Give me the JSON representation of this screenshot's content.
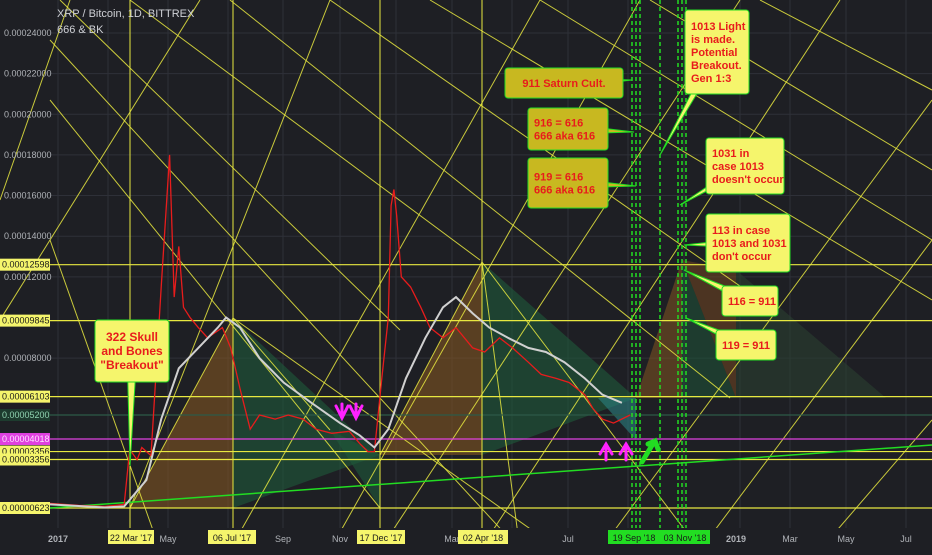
{
  "header": {
    "title": "XRP / Bitcoin, 1D, BITTREX",
    "subtitle": "666 & BK"
  },
  "chart_data": {
    "type": "line",
    "y_ticks": [
      "0.00024000",
      "0.00022000",
      "0.00020000",
      "0.00018000",
      "0.00016000",
      "0.00014000",
      "0.00012000",
      "0.00008000"
    ],
    "y_tick_values": [
      0.00024,
      0.00022,
      0.0002,
      0.00018,
      0.00016,
      0.00014,
      0.00012,
      8e-05
    ],
    "price_labels": [
      {
        "text": "0.00012598",
        "value": 0.00012598,
        "bg": "#f5f56c"
      },
      {
        "text": "0.00009845",
        "value": 9.845e-05,
        "bg": "#f5f56c"
      },
      {
        "text": "0.00006103",
        "value": 6.103e-05,
        "bg": "#f5f56c"
      },
      {
        "text": "0.00005200",
        "value": 5.2e-05,
        "bg": "#1d3b2e"
      },
      {
        "text": "0.00004018",
        "value": 4.018e-05,
        "bg": "#e040e0"
      },
      {
        "text": "0.00003356",
        "value": 3.4e-05,
        "bg": "#f5f56c"
      },
      {
        "text": "0.00003356",
        "value": 3.01e-05,
        "bg": "#f5f56c"
      },
      {
        "text": "0.00000623",
        "value": 6.23e-06,
        "bg": "#f5f56c"
      }
    ],
    "x_ticks": [
      "2017",
      "May",
      "Sep",
      "Nov",
      "Mar",
      "Jul",
      "2019",
      "Mar",
      "May",
      "Jul"
    ],
    "date_labels": [
      {
        "text": "22 Mar '17",
        "bg": "#f5f56c"
      },
      {
        "text": "06 Jul '17",
        "bg": "#f5f56c"
      },
      {
        "text": "17 Dec '17",
        "bg": "#f5f56c"
      },
      {
        "text": "02 Apr '18",
        "bg": "#f5f56c"
      },
      {
        "text": "19 Sep '18",
        "bg": "#22dd22"
      },
      {
        "text": "03 Nov '18",
        "bg": "#22dd22"
      }
    ],
    "series": [
      {
        "color": "#e81c1c",
        "x": [
          "2017-01-01",
          "2017-02-01",
          "2017-03-01",
          "2017-03-22",
          "2017-03-28",
          "2017-04-05",
          "2017-04-10",
          "2017-04-20",
          "2017-04-25",
          "2017-05-01",
          "2017-05-10",
          "2017-05-15",
          "2017-05-20",
          "2017-05-25",
          "2017-06-01",
          "2017-06-10",
          "2017-06-20",
          "2017-07-06",
          "2017-07-15",
          "2017-07-25",
          "2017-08-05",
          "2017-08-15",
          "2017-09-01",
          "2017-09-15",
          "2017-10-01",
          "2017-10-15",
          "2017-11-01",
          "2017-11-20",
          "2017-12-01",
          "2017-12-10",
          "2017-12-17",
          "2017-12-25",
          "2018-01-01",
          "2018-01-04",
          "2018-01-07",
          "2018-01-10",
          "2018-01-15",
          "2018-01-25",
          "2018-02-05",
          "2018-02-15",
          "2018-03-01",
          "2018-03-15",
          "2018-04-02",
          "2018-04-15",
          "2018-05-01",
          "2018-05-15",
          "2018-06-01",
          "2018-06-15",
          "2018-07-01",
          "2018-07-15",
          "2018-08-01",
          "2018-08-10",
          "2018-08-20",
          "2018-09-01",
          "2018-09-19"
        ],
        "y": [
          8.5e-06,
          7.5e-06,
          7e-06,
          8e-06,
          3.5e-05,
          3e-05,
          3.6e-05,
          3.2e-05,
          7e-05,
          0.000115,
          0.00018,
          0.00011,
          0.000135,
          0.000105,
          0.0001,
          9.5e-05,
          9e-05,
          9.5e-05,
          8.5e-05,
          6.5e-05,
          4.5e-05,
          5.2e-05,
          5e-05,
          5.2e-05,
          5e-05,
          4.5e-05,
          4.3e-05,
          4.4e-05,
          3.8e-05,
          3.4e-05,
          3.4e-05,
          7e-05,
          0.0001,
          0.000155,
          0.000163,
          0.00015,
          0.00012,
          0.000115,
          0.000105,
          9.5e-05,
          9e-05,
          9.5e-05,
          8.5e-05,
          8.3e-05,
          9e-05,
          8.5e-05,
          7.8e-05,
          7.2e-05,
          7e-05,
          6.8e-05,
          6.2e-05,
          5.5e-05,
          5e-05,
          4.8e-05,
          5.2e-05
        ]
      },
      {
        "color": "#d0d0d0",
        "x": [
          "2017-01-01",
          "2017-03-01",
          "2017-03-22",
          "2017-04-15",
          "2017-05-01",
          "2017-05-20",
          "2017-06-10",
          "2017-07-01",
          "2017-07-10",
          "2017-07-25",
          "2017-08-15",
          "2017-09-10",
          "2017-10-10",
          "2017-11-10",
          "2017-12-01",
          "2017-12-17",
          "2018-01-01",
          "2018-01-20",
          "2018-02-10",
          "2018-03-01",
          "2018-03-15",
          "2018-04-02",
          "2018-04-20",
          "2018-05-10",
          "2018-06-01",
          "2018-06-20",
          "2018-07-10",
          "2018-08-01",
          "2018-08-20",
          "2018-09-10"
        ],
        "y": [
          8e-06,
          6.5e-06,
          7e-06,
          2e-05,
          5e-05,
          7.5e-05,
          8.5e-05,
          9.5e-05,
          0.0001,
          9.5e-05,
          8e-05,
          6.8e-05,
          5.8e-05,
          4.8e-05,
          4.2e-05,
          3.6e-05,
          4.5e-05,
          7e-05,
          9e-05,
          0.000105,
          0.00011,
          0.000102,
          9.5e-05,
          9e-05,
          8.5e-05,
          8.3e-05,
          7.8e-05,
          7e-05,
          6.2e-05,
          5.8e-05
        ]
      }
    ],
    "annotations": [
      {
        "lines": [
          "322 Skull",
          "and Bones",
          "\"Breakout\""
        ],
        "bg": "#f5f56c",
        "text_color": "#e81c1c",
        "border": "#22dd22"
      },
      {
        "lines": [
          "911 Saturn Cult."
        ],
        "bg": "#c8b820",
        "text_color": "#e81c1c",
        "border": "#22dd22"
      },
      {
        "lines": [
          "916 = 616",
          "666 aka 616"
        ],
        "bg": "#c8b820",
        "text_color": "#e81c1c",
        "border": "#22dd22"
      },
      {
        "lines": [
          "919 = 616",
          "666 aka 616"
        ],
        "bg": "#c8b820",
        "text_color": "#e81c1c",
        "border": "#22dd22"
      },
      {
        "lines": [
          "1013 Light",
          "is made.",
          "Potential",
          "Breakout.",
          "Gen 1:3"
        ],
        "bg": "#f5f56c",
        "text_color": "#e81c1c",
        "border": "#22dd22"
      },
      {
        "lines": [
          "1031 in",
          "case 1013",
          "doesn't occur"
        ],
        "bg": "#f5f56c",
        "text_color": "#e81c1c",
        "border": "#22dd22"
      },
      {
        "lines": [
          "113  in case",
          "1013 and 1031",
          "don't occur"
        ],
        "bg": "#f5f56c",
        "text_color": "#e81c1c",
        "border": "#22dd22"
      },
      {
        "lines": [
          "116 = 911"
        ],
        "bg": "#f5f56c",
        "text_color": "#e81c1c",
        "border": "#22dd22"
      },
      {
        "lines": [
          "119 = 911"
        ],
        "bg": "#f5f56c",
        "text_color": "#e81c1c",
        "border": "#22dd22"
      }
    ],
    "arrows": [
      {
        "name": "magenta-down-arrow",
        "color": "#ff22ff"
      },
      {
        "name": "magenta-down-arrow",
        "color": "#ff22ff"
      },
      {
        "name": "magenta-up-arrow",
        "color": "#ff22ff"
      },
      {
        "name": "magenta-up-arrow",
        "color": "#ff22ff"
      },
      {
        "name": "green-up-arrow",
        "color": "#22dd22"
      }
    ],
    "colors": {
      "background": "#1e1f24",
      "grid": "#2e3038",
      "gann_lines": "#e8e840",
      "horizontal_levels": "#e8e840",
      "magenta_level": "#e040e0",
      "trendline": "#22dd22",
      "cycle_lines": "#22dd22",
      "wedge_orange": "#8a5a20",
      "wedge_green": "#1e5a3a"
    }
  }
}
